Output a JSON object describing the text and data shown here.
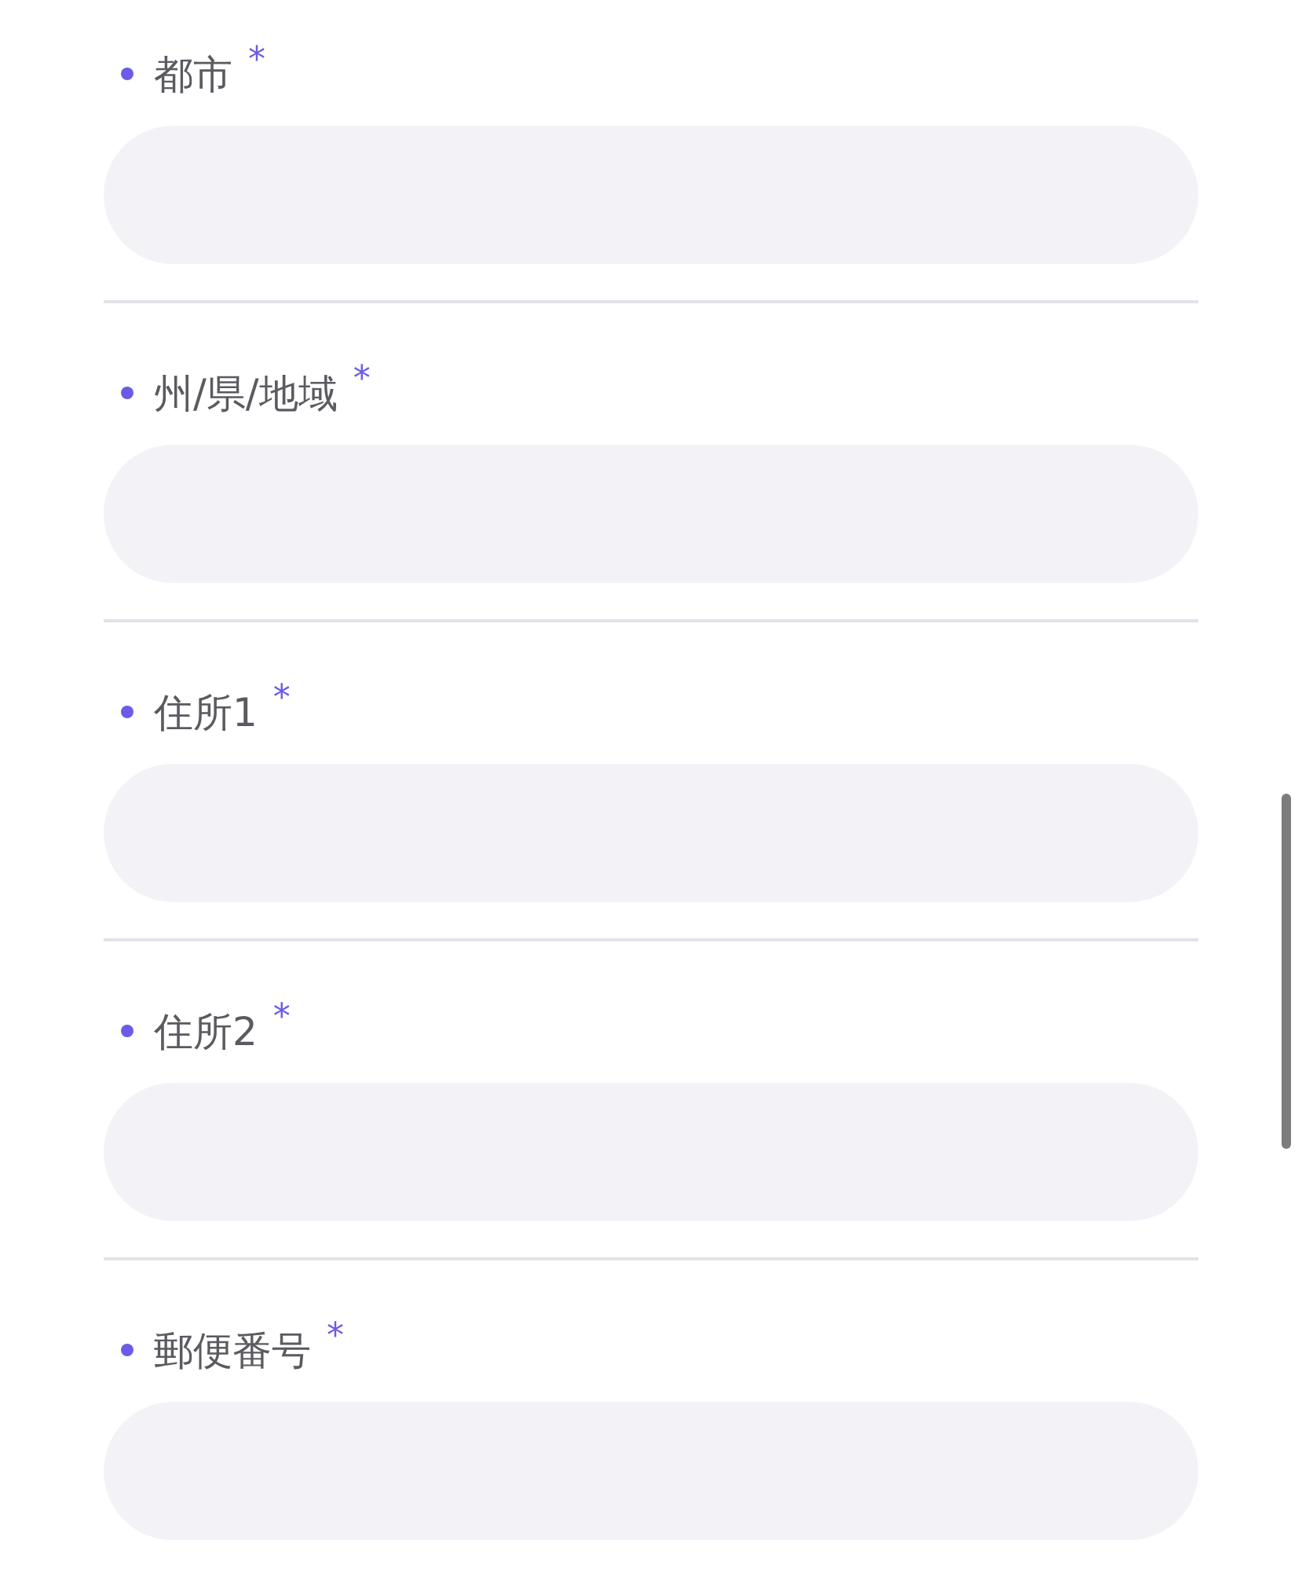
{
  "fields": [
    {
      "label": "都市",
      "required_mark": "*"
    },
    {
      "label": "州/県/地域",
      "required_mark": "*"
    },
    {
      "label": "住所1",
      "required_mark": "*"
    },
    {
      "label": "住所2",
      "required_mark": "*"
    },
    {
      "label": "郵便番号",
      "required_mark": "*"
    }
  ]
}
